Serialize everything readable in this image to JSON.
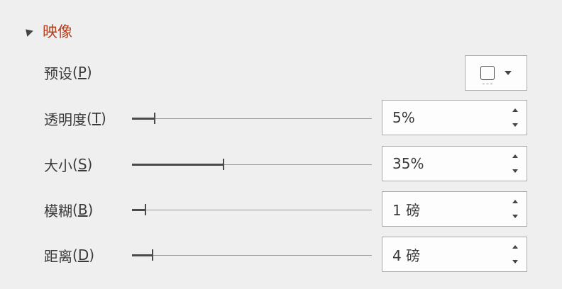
{
  "section": {
    "title": "映像"
  },
  "preset": {
    "label": "预设",
    "key": "P"
  },
  "rows": [
    {
      "label": "透明度",
      "key": "T",
      "value": "5%",
      "level": 0.05
    },
    {
      "label": "大小",
      "key": "S",
      "value": "35%",
      "level": 0.35
    },
    {
      "label": "模糊",
      "key": "B",
      "value": "1 磅",
      "level": 0.01
    },
    {
      "label": "距离",
      "key": "D",
      "value": "4 磅",
      "level": 0.04
    }
  ]
}
